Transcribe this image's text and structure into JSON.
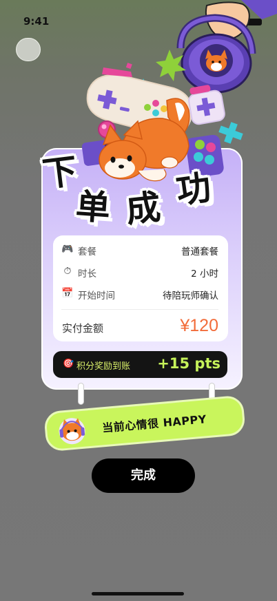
{
  "status_bar": {
    "time": "9:41"
  },
  "title_chars": [
    "下",
    "单",
    "成",
    "功"
  ],
  "order_details": {
    "rows": [
      {
        "icon": "gamepad-icon",
        "glyph": "🎮",
        "label": "套餐",
        "value": "普通套餐"
      },
      {
        "icon": "stopwatch-icon",
        "glyph": "⏱",
        "label": "时长",
        "value": "2 小时"
      },
      {
        "icon": "calendar-icon",
        "glyph": "📅",
        "label": "开始时间",
        "value": "待陪玩师确认"
      }
    ],
    "paid_label": "实付金额",
    "paid_value": "¥120"
  },
  "points": {
    "label": "积分奖励到账",
    "value": "+15 pts"
  },
  "mood_banner": {
    "text": "当前心情很 HAPPY"
  },
  "done_button": {
    "label": "完成"
  },
  "colors": {
    "accent_orange": "#f26c3a",
    "lime": "#c9f55c",
    "purple": "#7b5bd6",
    "card_top": "#c5b0f7"
  }
}
